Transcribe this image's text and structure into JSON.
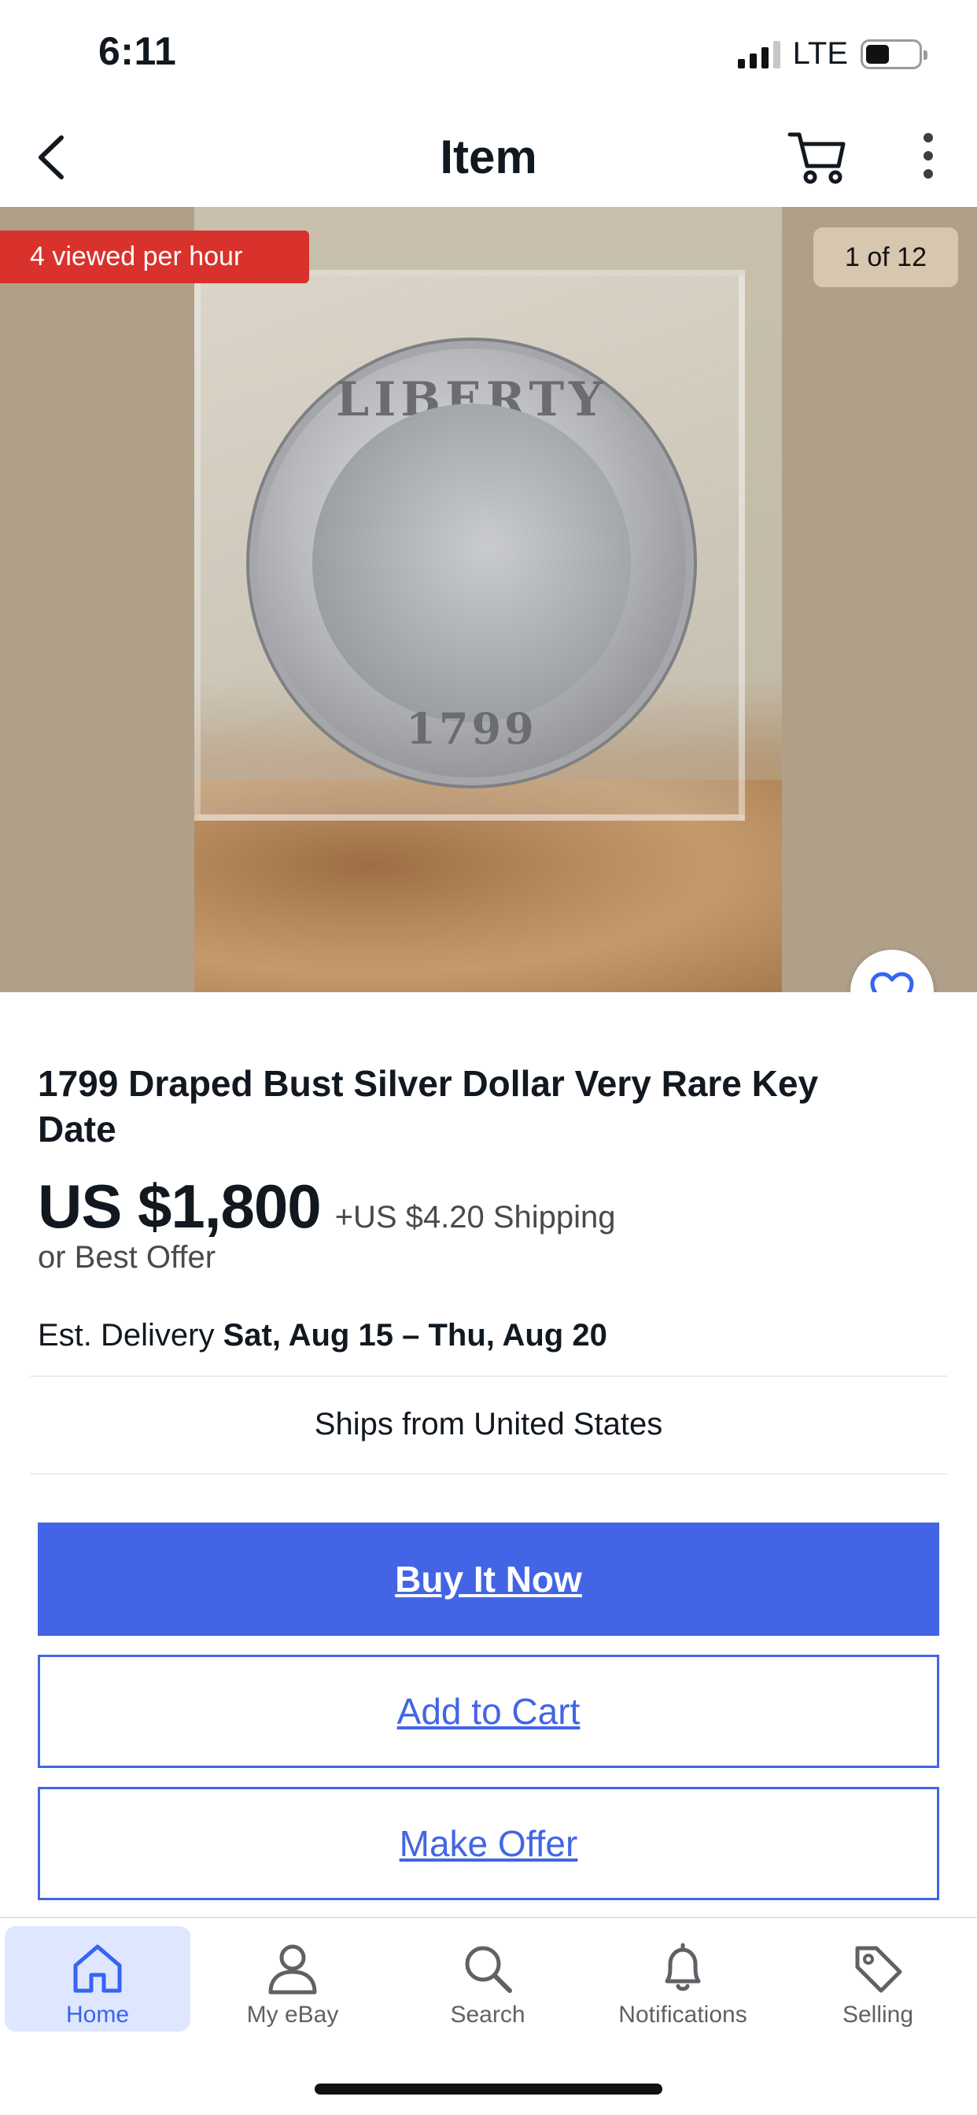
{
  "status_bar": {
    "time": "6:11",
    "network": "LTE"
  },
  "header": {
    "title": "Item",
    "icons": [
      "chevron-left-icon",
      "cart-icon",
      "more-vertical-icon"
    ]
  },
  "gallery": {
    "viewed_badge": "4 viewed per hour",
    "counter": "1 of 12",
    "coin_legend": "LIBERTY",
    "coin_date": "1799"
  },
  "item": {
    "title": "1799 Draped Bust Silver Dollar Very Rare Key Date",
    "price": "US $1,800",
    "shipping": "+US $4.20 Shipping",
    "best_offer": "or Best Offer",
    "delivery_label": "Est. Delivery",
    "delivery_dates": "Sat, Aug 15 – Thu, Aug 20",
    "ships_from": "Ships from United States"
  },
  "actions": {
    "buy_now": "Buy It Now",
    "add_to_cart": "Add to Cart",
    "make_offer": "Make Offer"
  },
  "tabs": [
    {
      "label": "Home",
      "icon": "home-icon",
      "active": true
    },
    {
      "label": "My eBay",
      "icon": "person-icon",
      "active": false
    },
    {
      "label": "Search",
      "icon": "search-icon",
      "active": false
    },
    {
      "label": "Notifications",
      "icon": "bell-icon",
      "active": false
    },
    {
      "label": "Selling",
      "icon": "tag-icon",
      "active": false
    }
  ],
  "colors": {
    "accent": "#4365e5",
    "badge_red": "#d9322c",
    "tab_active_bg": "#dfe6ff"
  }
}
